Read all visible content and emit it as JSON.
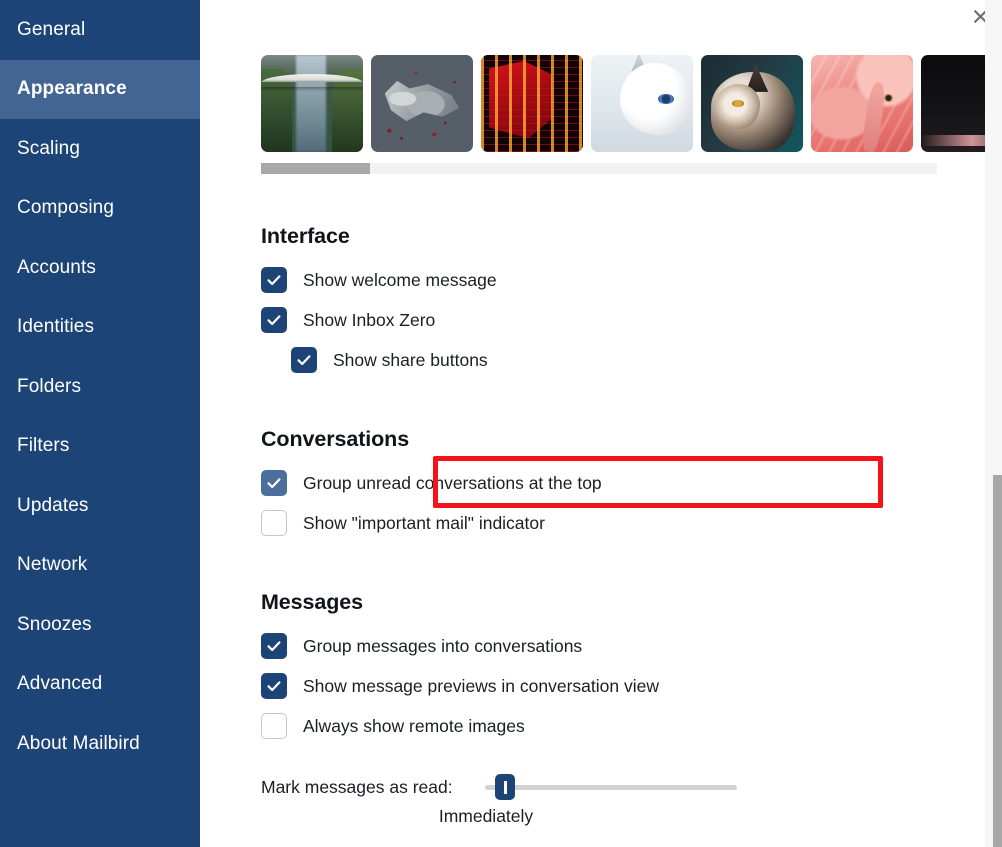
{
  "window": {
    "close_label": "×",
    "close_icon": "close-icon"
  },
  "sidebar": {
    "items": [
      {
        "label": "General",
        "active": false
      },
      {
        "label": "Appearance",
        "active": true
      },
      {
        "label": "Scaling",
        "active": false
      },
      {
        "label": "Composing",
        "active": false
      },
      {
        "label": "Accounts",
        "active": false
      },
      {
        "label": "Identities",
        "active": false
      },
      {
        "label": "Folders",
        "active": false
      },
      {
        "label": "Filters",
        "active": false
      },
      {
        "label": "Updates",
        "active": false
      },
      {
        "label": "Network",
        "active": false
      },
      {
        "label": "Snoozes",
        "active": false
      },
      {
        "label": "Advanced",
        "active": false
      },
      {
        "label": "About Mailbird",
        "active": false
      }
    ]
  },
  "theme_thumbnails": [
    {
      "name": "waterfall-bridge-thumbnail"
    },
    {
      "name": "direwolf-sigil-thumbnail"
    },
    {
      "name": "red-circuit-board-thumbnail"
    },
    {
      "name": "white-cat-thumbnail"
    },
    {
      "name": "tabby-cat-thumbnail"
    },
    {
      "name": "flamingo-thumbnail"
    },
    {
      "name": "dark-thumbnail-partial"
    }
  ],
  "sections": {
    "interface": {
      "title": "Interface",
      "options": [
        {
          "label": "Show welcome message",
          "checked": true,
          "indent": false,
          "highlighted": false
        },
        {
          "label": "Show Inbox Zero",
          "checked": true,
          "indent": false,
          "highlighted": false
        },
        {
          "label": "Show share buttons",
          "checked": true,
          "indent": true,
          "highlighted": false
        }
      ]
    },
    "conversations": {
      "title": "Conversations",
      "options": [
        {
          "label": "Group unread conversations at the top",
          "checked": true,
          "indent": false,
          "highlighted": true
        },
        {
          "label": "Show \"important mail\" indicator",
          "checked": false,
          "indent": false,
          "highlighted": false
        }
      ]
    },
    "messages": {
      "title": "Messages",
      "options": [
        {
          "label": "Group messages into conversations",
          "checked": true,
          "indent": false,
          "highlighted": false
        },
        {
          "label": "Show message previews in conversation view",
          "checked": true,
          "indent": false,
          "highlighted": false
        },
        {
          "label": "Always show remote images",
          "checked": false,
          "indent": false,
          "highlighted": false
        }
      ]
    }
  },
  "slider": {
    "label": "Mark messages as read:",
    "value_label": "Immediately",
    "position_percent": 4
  },
  "colors": {
    "sidebar_bg": "#1d4477",
    "sidebar_active_bg": "#426593",
    "checkbox_checked": "#1d4477",
    "checkbox_hover": "#4a6f9c",
    "highlight_border": "#f3131b",
    "scrollbar_thumb": "#a8a8a8"
  }
}
